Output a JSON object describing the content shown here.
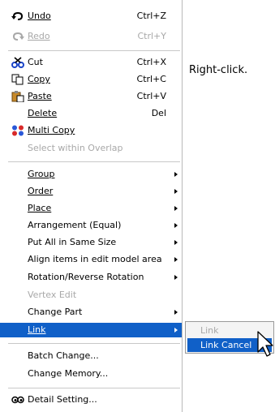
{
  "caption": "Right-click.",
  "menu": {
    "undo": {
      "label": "Undo",
      "shortcut": "Ctrl+Z",
      "icon": "undo-arrow-icon"
    },
    "redo": {
      "label": "Redo",
      "shortcut": "Ctrl+Y",
      "icon": "redo-arrow-icon"
    },
    "cut": {
      "label": "Cut",
      "shortcut": "Ctrl+X",
      "icon": "scissors-icon"
    },
    "copy": {
      "label": "Copy",
      "shortcut": "Ctrl+C",
      "icon": "copy-pages-icon"
    },
    "paste": {
      "label": "Paste",
      "shortcut": "Ctrl+V",
      "icon": "clipboard-icon"
    },
    "delete": {
      "label": "Delete",
      "shortcut": "Del"
    },
    "multi_copy": {
      "label": "Multi Copy",
      "icon": "multi-copy-icon"
    },
    "select_within_overlap": {
      "label": "Select within Overlap"
    },
    "group": {
      "label": "Group"
    },
    "order": {
      "label": "Order"
    },
    "place": {
      "label": "Place"
    },
    "arrangement_equal": {
      "label": "Arrangement (Equal)"
    },
    "put_all_same_size": {
      "label": "Put All in Same Size"
    },
    "align_items": {
      "label": "Align items in edit model area"
    },
    "rotation": {
      "label": "Rotation/Reverse Rotation"
    },
    "vertex_edit": {
      "label": "Vertex Edit"
    },
    "change_part": {
      "label": "Change Part"
    },
    "link": {
      "label": "Link"
    },
    "batch_change": {
      "label": "Batch Change..."
    },
    "change_memory": {
      "label": "Change Memory..."
    },
    "detail_setting": {
      "label": "Detail Setting...",
      "icon": "glasses-icon"
    }
  },
  "submenu": {
    "link": {
      "label": "Link"
    },
    "link_cancel": {
      "label": "Link Cancel"
    }
  },
  "colors": {
    "highlight": "#1060c8",
    "disabled_text": "#a8a8a8"
  }
}
